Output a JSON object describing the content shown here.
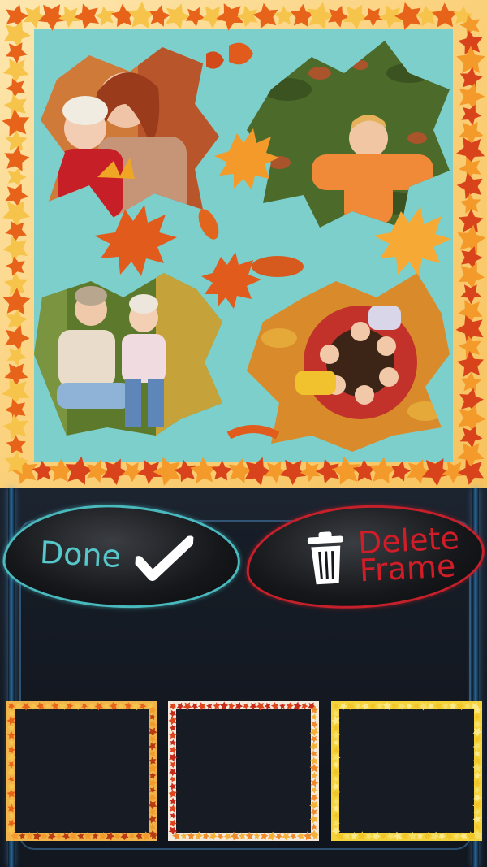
{
  "collage": {
    "photos": [
      {
        "name": "mother-child-photo"
      },
      {
        "name": "boy-lying-on-leaves-photo"
      },
      {
        "name": "mother-daughter-autumn-photo"
      },
      {
        "name": "children-circle-on-leaves-photo"
      }
    ],
    "colors": {
      "background": "#7dcfcb",
      "border_leaves": [
        "#e8631a",
        "#f39a2b",
        "#f6c44a",
        "#d9431c"
      ]
    }
  },
  "buttons": {
    "done_label": "Done",
    "delete_line1": "Delete",
    "delete_line2": "Frame"
  },
  "frames": [
    {
      "name": "autumn-leaf-frame-orange",
      "selected": true
    },
    {
      "name": "autumn-leaf-frame-red-orange",
      "selected": false
    },
    {
      "name": "yellow-leaf-frame",
      "selected": false
    }
  ]
}
